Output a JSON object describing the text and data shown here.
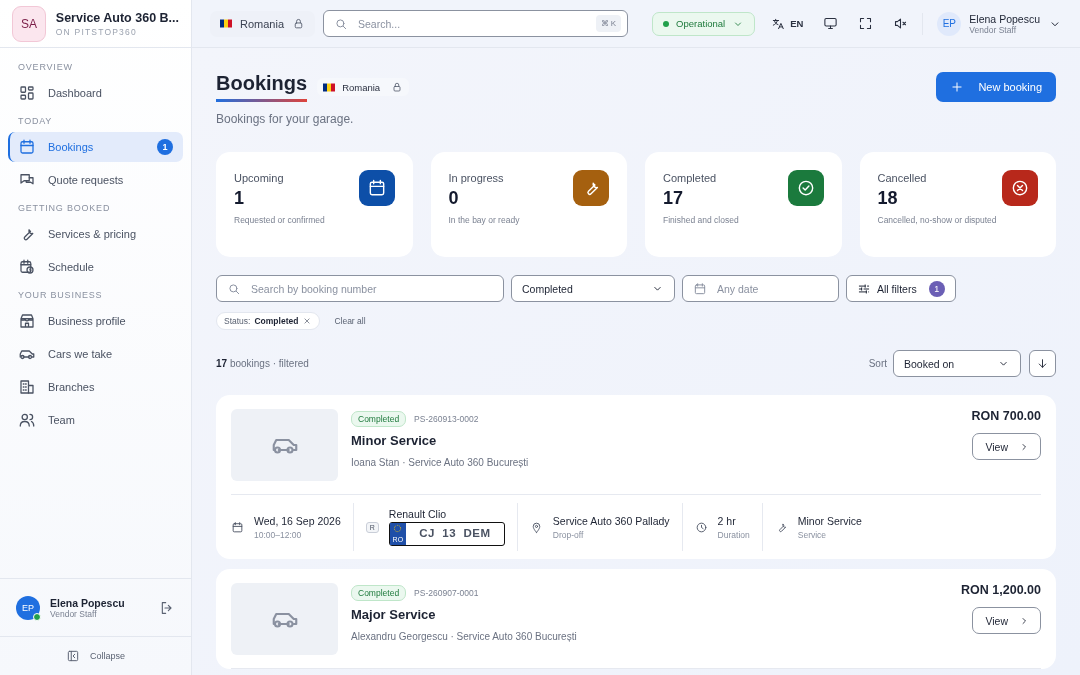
{
  "sidebar": {
    "brand": {
      "initials": "SA",
      "name": "Service Auto 360 B...",
      "sub": "ON PITSTOP360"
    },
    "sections": [
      {
        "heading": "OVERVIEW",
        "items": [
          {
            "label": "Dashboard",
            "selected": false
          }
        ]
      },
      {
        "heading": "TODAY",
        "items": [
          {
            "label": "Bookings",
            "selected": true,
            "badge": "1"
          },
          {
            "label": "Quote requests",
            "selected": false
          }
        ]
      },
      {
        "heading": "GETTING BOOKED",
        "items": [
          {
            "label": "Services & pricing",
            "selected": false
          },
          {
            "label": "Schedule",
            "selected": false
          }
        ]
      },
      {
        "heading": "YOUR BUSINESS",
        "items": [
          {
            "label": "Business profile",
            "selected": false
          },
          {
            "label": "Cars we take",
            "selected": false
          },
          {
            "label": "Branches",
            "selected": false
          },
          {
            "label": "Team",
            "selected": false
          }
        ]
      }
    ],
    "user": {
      "initials": "EP",
      "name": "Elena Popescu",
      "role": "Vendor Staff",
      "online": true
    },
    "collapse": "Collapse"
  },
  "topbar": {
    "region": {
      "label": "Romania",
      "locked": true
    },
    "search": {
      "placeholder": "Search...",
      "shortcut": "⌘ K"
    },
    "status": {
      "label": "Operational",
      "color": "#22a04b"
    },
    "language": "EN",
    "muted": true,
    "user": {
      "initials": "EP",
      "name": "Elena Popescu",
      "role": "Vendor Staff"
    }
  },
  "header": {
    "title": "Bookings",
    "region": {
      "label": "Romania",
      "locked": true
    },
    "subtitle": "Bookings for your garage.",
    "new_button": "New booking"
  },
  "stats": [
    {
      "label": "Upcoming",
      "value": "1",
      "caption": "Requested or confirmed",
      "color": "#0d4fa8"
    },
    {
      "label": "In progress",
      "value": "0",
      "caption": "In the bay or ready",
      "color": "#a5600f"
    },
    {
      "label": "Completed",
      "value": "17",
      "caption": "Finished and closed",
      "color": "#1b7a3d"
    },
    {
      "label": "Cancelled",
      "value": "18",
      "caption": "Cancelled, no-show or disputed",
      "color": "#b8281b"
    }
  ],
  "filters": {
    "search": {
      "placeholder": "Search by booking number"
    },
    "status": "Completed",
    "date": {
      "placeholder": "Any date"
    },
    "all_filters": {
      "label": "All filters",
      "count": "1"
    }
  },
  "chips": [
    {
      "label": "Status:",
      "value": "Completed"
    }
  ],
  "clear_all": "Clear all",
  "summary": {
    "count": "17",
    "text": "bookings · filtered"
  },
  "sort": {
    "label": "Sort",
    "value": "Booked on"
  },
  "bookings": [
    {
      "status": "Completed",
      "number": "PS-260913-0002",
      "title": "Minor Service",
      "subtitle": "Ioana Stan · Service Auto 360 București",
      "price": "RON 700.00",
      "view": "View",
      "details": {
        "date": "Wed, 16 Sep 2026",
        "time": "10:00–12:00",
        "car_tag": "R",
        "car": "Renault Clio",
        "plate_country": "RO",
        "plate": "CJ  13  DEM",
        "location": "Service Auto 360 Pallady",
        "location_sub": "Drop-off",
        "duration": "2 hr",
        "duration_sub": "Duration",
        "service": "Minor Service",
        "service_sub": "Service"
      }
    },
    {
      "status": "Completed",
      "number": "PS-260907-0001",
      "title": "Major Service",
      "subtitle": "Alexandru Georgescu · Service Auto 360 București",
      "price": "RON 1,200.00",
      "view": "View"
    }
  ]
}
